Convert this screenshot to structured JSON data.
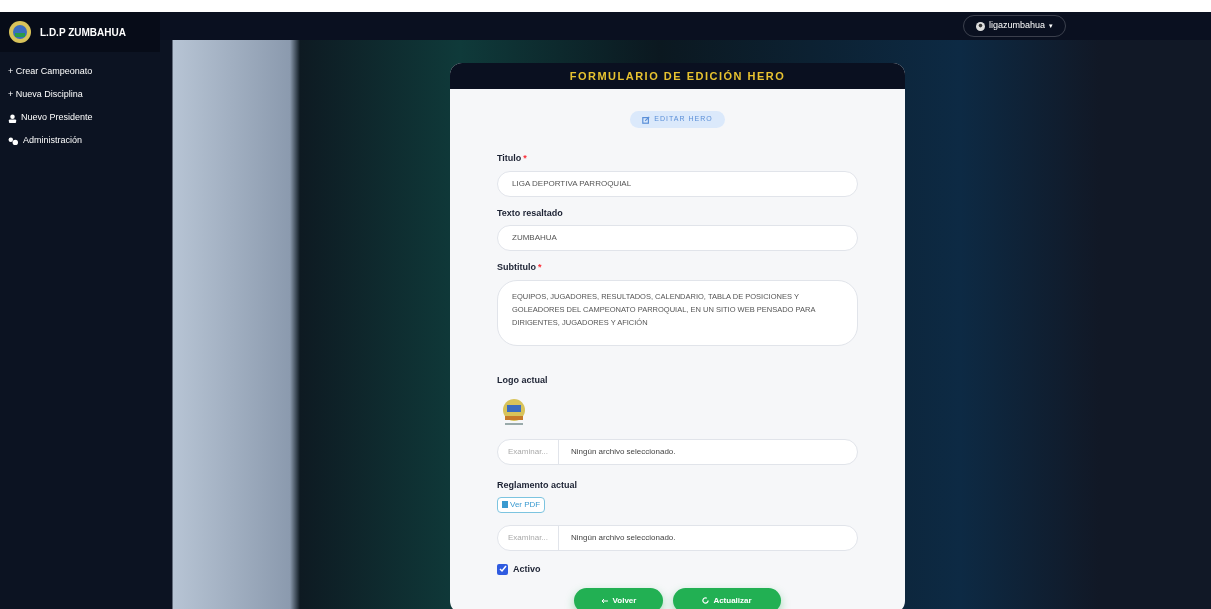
{
  "sidebar": {
    "brand": "L.D.P ZUMBAHUA",
    "items": [
      {
        "kind": "plain",
        "label": "+ Crear Campeonato"
      },
      {
        "kind": "plain",
        "label": "+ Nueva Disciplina"
      },
      {
        "kind": "user",
        "label": "Nuevo Presidente"
      },
      {
        "kind": "users",
        "label": "Administración"
      }
    ]
  },
  "navbar": {
    "user": "ligazumbahua",
    "caret": "▾"
  },
  "form": {
    "title": "FORMULARIO DE EDICIÓN HERO",
    "badge": "EDITAR HERO",
    "fields": [
      {
        "kind": "text",
        "label": "Titulo",
        "required_mark": "*",
        "value": "LIGA DEPORTIVA PARROQUIAL"
      },
      {
        "kind": "text",
        "label": "Texto resaltado",
        "value": "ZUMBAHUA"
      },
      {
        "kind": "textarea",
        "label": "Subtitulo",
        "required_mark": "*",
        "value": "EQUIPOS, JUGADORES, RESULTADOS, CALENDARIO, TABLA DE POSICIONES Y GOLEADORES DEL CAMPEONATO PARROQUIAL, EN UN SITIO WEB PENSADO PARA DIRIGENTES, JUGADORES Y AFICIÓN"
      },
      {
        "kind": "logo",
        "label": "Logo actual"
      },
      {
        "kind": "file",
        "button": "Examinar...",
        "value": "Ningún archivo seleccionado."
      },
      {
        "kind": "pdf",
        "label": "Reglamento actual",
        "button": "Ver PDF"
      },
      {
        "kind": "file",
        "button": "Examinar...",
        "value": "Ningún archivo seleccionado."
      },
      {
        "kind": "checkbox",
        "label": "Activo",
        "checked": true
      }
    ],
    "buttons": [
      {
        "kind": "back",
        "label": "Volver"
      },
      {
        "kind": "update",
        "label": "Actualizar"
      }
    ]
  }
}
